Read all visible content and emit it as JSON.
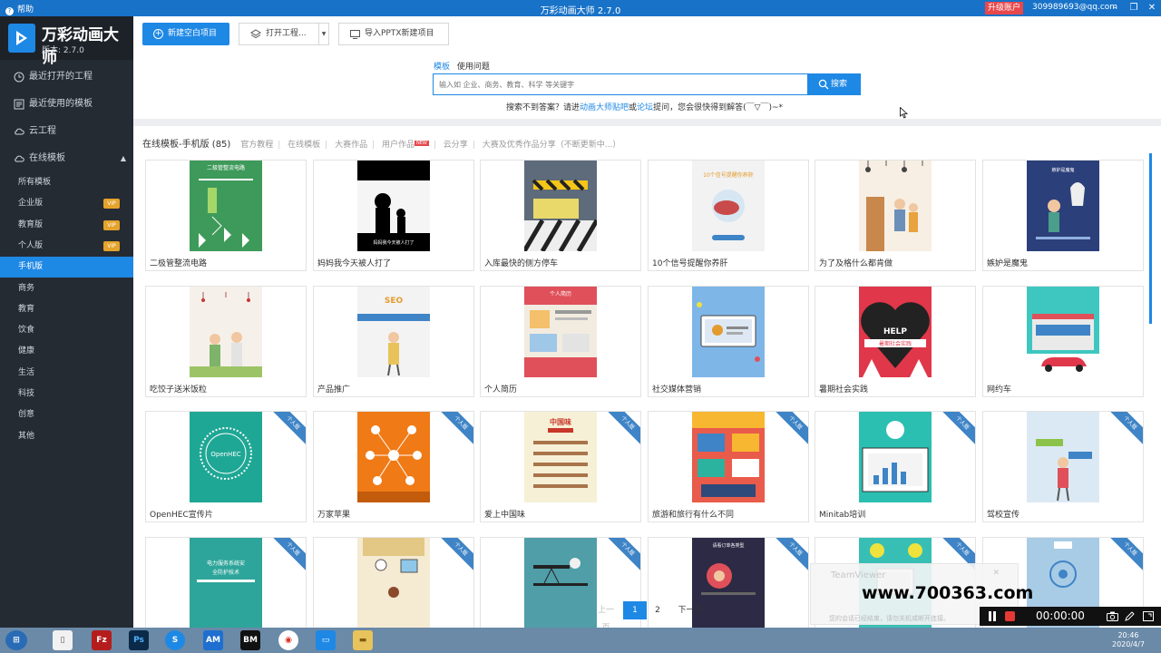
{
  "window": {
    "help": "帮助",
    "title": "万彩动画大师 2.7.0",
    "upgrade": "升级账户",
    "account": "309989693@qq.com"
  },
  "brand": {
    "name": "万彩动画大师",
    "version": "版本: 2.7.0"
  },
  "sidebar": {
    "recent_projects": "最近打开的工程",
    "recent_templates": "最近使用的模板",
    "cloud": "云工程",
    "online": "在线模板",
    "sub": [
      {
        "label": "所有模板",
        "vip": ""
      },
      {
        "label": "企业版",
        "vip": "VIP"
      },
      {
        "label": "教育版",
        "vip": "VIP"
      },
      {
        "label": "个人版",
        "vip": "VIP"
      },
      {
        "label": "手机版",
        "vip": ""
      },
      {
        "label": "商务",
        "vip": ""
      },
      {
        "label": "教育",
        "vip": ""
      },
      {
        "label": "饮食",
        "vip": ""
      },
      {
        "label": "健康",
        "vip": ""
      },
      {
        "label": "生活",
        "vip": ""
      },
      {
        "label": "科技",
        "vip": ""
      },
      {
        "label": "创意",
        "vip": ""
      },
      {
        "label": "其他",
        "vip": ""
      }
    ]
  },
  "toolbar": {
    "new": "新建空白项目",
    "open": "打开工程...",
    "ppt": "导入PPTX新建项目"
  },
  "search": {
    "tab_template": "模板",
    "tab_help": "使用问题",
    "placeholder": "输入如 企业、商务、教育、科学 等关键字",
    "button": "搜索",
    "hint_a": "搜索不到答案？请进",
    "hint_link1": "动画大师贴吧",
    "hint_b": "或",
    "hint_link2": "论坛",
    "hint_c": "提问，您会很快得到解答(￣▽￣)~*"
  },
  "crumbs": {
    "main": "在线模板-手机版 (85)",
    "items": [
      "官方教程",
      "在线模板",
      "大赛作品",
      "用户作品",
      "云分享",
      "大赛及优秀作品分享（不断更新中...）"
    ],
    "new_badge": "NEW"
  },
  "cards": [
    {
      "label": "二极管整流电路",
      "ribbon": ""
    },
    {
      "label": "妈妈我今天被人打了",
      "ribbon": ""
    },
    {
      "label": "入库最快的侧方停车",
      "ribbon": ""
    },
    {
      "label": "10个信号提醒你养肝",
      "ribbon": ""
    },
    {
      "label": "为了及格什么都肯做",
      "ribbon": ""
    },
    {
      "label": "嫉妒是魔鬼",
      "ribbon": ""
    },
    {
      "label": "吃饺子送米饭粒",
      "ribbon": ""
    },
    {
      "label": "产品推广",
      "ribbon": ""
    },
    {
      "label": "个人简历",
      "ribbon": ""
    },
    {
      "label": "社交媒体营销",
      "ribbon": ""
    },
    {
      "label": "暑期社会实践",
      "ribbon": ""
    },
    {
      "label": "网约车",
      "ribbon": ""
    },
    {
      "label": "OpenHEC宣传片",
      "ribbon": "个人版"
    },
    {
      "label": "万家苹果",
      "ribbon": "个人版"
    },
    {
      "label": "爱上中国味",
      "ribbon": "个人版"
    },
    {
      "label": "旅游和旅行有什么不同",
      "ribbon": "个人版"
    },
    {
      "label": "Minitab培训",
      "ribbon": "个人版"
    },
    {
      "label": "驾校宣传",
      "ribbon": "个人版"
    },
    {
      "label": "",
      "ribbon": "个人版"
    },
    {
      "label": "",
      "ribbon": "个人版"
    },
    {
      "label": "",
      "ribbon": "个人版"
    },
    {
      "label": "",
      "ribbon": "个人版"
    },
    {
      "label": "",
      "ribbon": "个人版"
    },
    {
      "label": "",
      "ribbon": "个人版"
    }
  ],
  "thumb_text": {
    "c0": "二极管整流电路",
    "c1": "妈妈我今天被人打了",
    "c3": "10个信号提醒你养肝",
    "c8": "个人简历",
    "c10": "HELP",
    "c10b": "暑期社会实践",
    "c12": "OpenHEC",
    "c14": "中国味",
    "c7": "SEO"
  },
  "pager": {
    "prev": "上一页",
    "p1": "1",
    "p2": "2",
    "next": "下一页"
  },
  "teamviewer": {
    "title": "TeamViewer",
    "sub": "您的会话已经结束，请勿关机或断开连接。"
  },
  "watermark": "www.700363.com",
  "recorder": {
    "time": "00:00:00"
  },
  "clock": {
    "time": "20:46",
    "date": "2020/4/7"
  },
  "colors": {
    "accent": "#1e88e5",
    "sidebar": "#252b33",
    "vip": "#e5a32b",
    "upgrade": "#e8474b"
  }
}
